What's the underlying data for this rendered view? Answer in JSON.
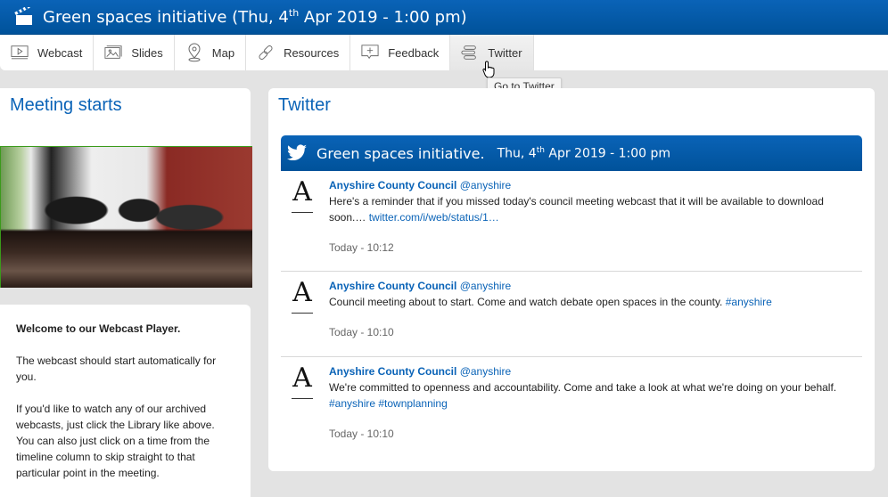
{
  "titlebar": {
    "icon": "clapperboard-icon",
    "title_prefix": "Green spaces initiative (Thu, 4",
    "title_sup": "th",
    "title_suffix": " Apr 2019 - 1:00 pm)"
  },
  "nav": {
    "items": [
      {
        "label": "Webcast",
        "icon": "video-player-icon"
      },
      {
        "label": "Slides",
        "icon": "image-slides-icon"
      },
      {
        "label": "Map",
        "icon": "map-pin-icon"
      },
      {
        "label": "Resources",
        "icon": "link-icon"
      },
      {
        "label": "Feedback",
        "icon": "feedback-comment-icon"
      },
      {
        "label": "Twitter",
        "icon": "twitter-feed-icon",
        "active": true
      }
    ],
    "tooltip": "Go to Twitter"
  },
  "left": {
    "heading": "Meeting starts",
    "welcome_title": "Welcome to our Webcast Player.",
    "para1": "The webcast should start automatically for you.",
    "para2": "If you'd like to watch any of our archived webcasts, just click the Library like above. You can also just click on a time from the timeline column to skip straight to that particular point in the meeting."
  },
  "twitter": {
    "heading": "Twitter",
    "header_name": "Green spaces initiative.",
    "header_date_prefix": "Thu, 4",
    "header_date_sup": "th",
    "header_date_suffix": " Apr 2019 - 1:00 pm",
    "tweets": [
      {
        "avatar": "A",
        "author": "Anyshire County Council",
        "handle": "@anyshire",
        "text": "Here's a reminder that if you missed today's council meeting webcast that it will be available to download soon.… ",
        "link": "twitter.com/i/web/status/1…",
        "time": "Today - 10:12"
      },
      {
        "avatar": "A",
        "author": "Anyshire County Council",
        "handle": "@anyshire",
        "text": "Council meeting about to start. Come and watch debate open spaces in the county. ",
        "link": "#anyshire",
        "time": "Today - 10:10"
      },
      {
        "avatar": "A",
        "author": "Anyshire County Council",
        "handle": "@anyshire",
        "text": "We're committed to openness and accountability. Come and take a look at what we're doing on your behalf. ",
        "link": "#anyshire #townplanning",
        "time": "Today - 10:10"
      }
    ]
  }
}
